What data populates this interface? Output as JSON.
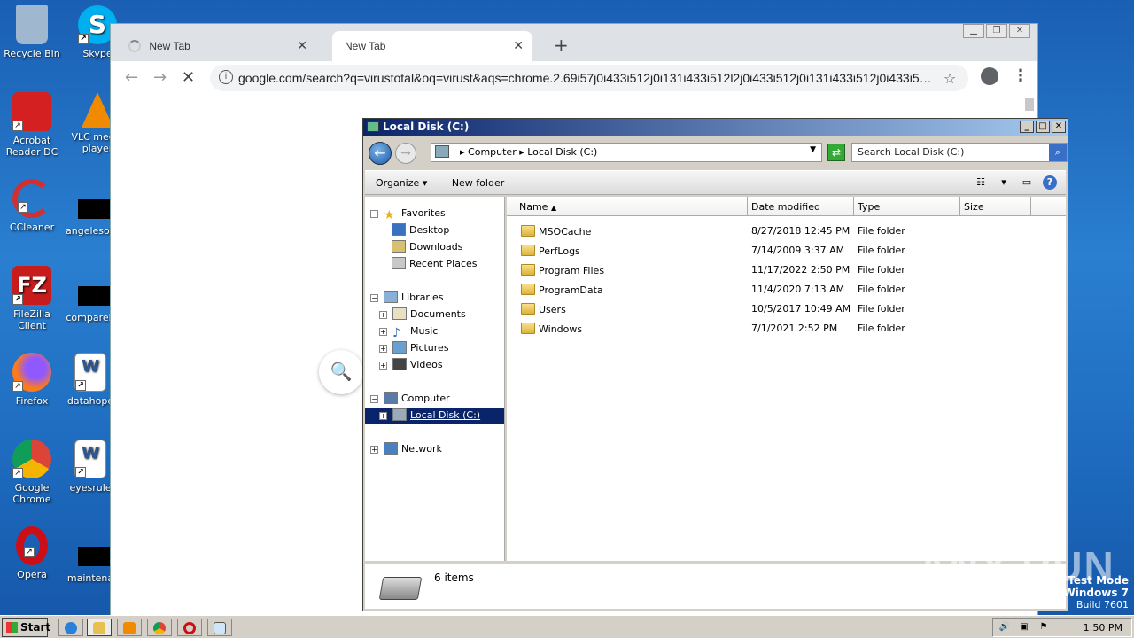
{
  "desktop": {
    "icons": [
      {
        "label": "Recycle Bin",
        "color": "#9fb8d0"
      },
      {
        "label": "Skype",
        "color": "#00aff0"
      },
      {
        "label": "Acrobat Reader DC",
        "color": "#d42020"
      },
      {
        "label": "VLC media player",
        "color": "#f08a00"
      },
      {
        "label": "CCleaner",
        "color": "#d03030"
      },
      {
        "label": "angelesob",
        "color": "#000000"
      },
      {
        "label": "FileZilla Client",
        "color": "#c81c1c"
      },
      {
        "label": "compareb",
        "color": "#000000"
      },
      {
        "label": "Firefox",
        "color": "#ff7a1a"
      },
      {
        "label": "datahope",
        "color": "#2b5797"
      },
      {
        "label": "Google Chrome",
        "color": "#4285f4"
      },
      {
        "label": "eyesrule",
        "color": "#2b5797"
      },
      {
        "label": "Opera",
        "color": "#cc0f16"
      },
      {
        "label": "maintena",
        "color": "#000000"
      }
    ]
  },
  "chrome": {
    "tabs": [
      {
        "title": "New Tab",
        "loading": true
      },
      {
        "title": "New Tab",
        "active": true
      }
    ],
    "close_glyph": "✕",
    "new_tab_glyph": "+",
    "url": "google.com/search?q=virustotal&oq=virust&aqs=chrome.2.69i57j0i433i512j0i131i433i512l2j0i433i512j0i131i433i512j0i433i5…",
    "back_glyph": "←",
    "forward_glyph": "→",
    "stop_glyph": "✕",
    "star_glyph": "☆",
    "menu_glyph": "⋮",
    "search_glyph": "🔍"
  },
  "explorer": {
    "title": "Local Disk (C:)",
    "address": {
      "crumbs": [
        "Computer",
        "Local Disk (C:)"
      ],
      "separator": "▸"
    },
    "search_placeholder": "Search Local Disk (C:)",
    "commands": {
      "organize": "Organize ▾",
      "new_folder": "New folder"
    },
    "nav": {
      "favorites": "Favorites",
      "desktop": "Desktop",
      "downloads": "Downloads",
      "recent": "Recent Places",
      "libraries": "Libraries",
      "documents": "Documents",
      "music": "Music",
      "pictures": "Pictures",
      "videos": "Videos",
      "computer": "Computer",
      "local_disk": "Local Disk (C:)",
      "network": "Network"
    },
    "columns": {
      "name": "Name",
      "date": "Date modified",
      "type": "Type",
      "size": "Size"
    },
    "files": [
      {
        "name": "MSOCache",
        "date": "8/27/2018 12:45 PM",
        "type": "File folder"
      },
      {
        "name": "PerfLogs",
        "date": "7/14/2009 3:37 AM",
        "type": "File folder"
      },
      {
        "name": "Program Files",
        "date": "11/17/2022 2:50 PM",
        "type": "File folder"
      },
      {
        "name": "ProgramData",
        "date": "11/4/2020 7:13 AM",
        "type": "File folder"
      },
      {
        "name": "Users",
        "date": "10/5/2017 10:49 AM",
        "type": "File folder"
      },
      {
        "name": "Windows",
        "date": "7/1/2021 2:52 PM",
        "type": "File folder"
      }
    ],
    "status": "6 items"
  },
  "watermark": "ANY RUN",
  "testmode": {
    "line1": "Test Mode",
    "line2": "Windows 7",
    "line3": "Build 7601"
  },
  "taskbar": {
    "start": "Start",
    "clock": "1:50 PM"
  }
}
